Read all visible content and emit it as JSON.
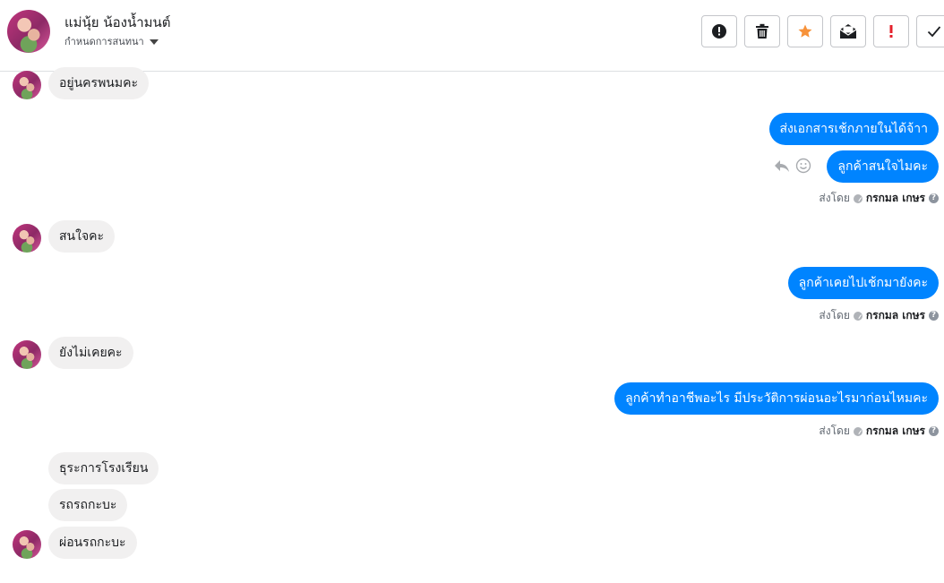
{
  "header": {
    "contact_name": "แม่นุ้ย น้องน้ำมนต์",
    "settings_label": "กำหนดการสนทนา"
  },
  "toolbar": {
    "buttons": [
      "report-spam",
      "delete",
      "star",
      "mark-unread",
      "mark-important",
      "mark-done"
    ]
  },
  "messages": {
    "m1": "อยู่นครพนมคะ",
    "m2": "ส่งเอกสารเช้กภายในได้จ้าา",
    "m3": "ลูกค้าสนใจไมคะ",
    "m4": "สนใจคะ",
    "m5": "ลูกค้าเคยไปเช้กมายังคะ",
    "m6": "ยังไม่เคยคะ",
    "m7": "ลูกค้าทำอาชีพอะไร  มีประวัติการผ่อนอะไรมาก่อนไหมคะ",
    "m8": "ธุระการโรงเรียน",
    "m9": "รถรถกะบะ",
    "m10": "ผ่อนรถกะบะ"
  },
  "sent_by": {
    "prefix": "ส่งโดย",
    "name": "กรกมล เกษร"
  },
  "colors": {
    "outgoing_bubble": "#0084ff",
    "incoming_bubble": "#f1f0f0",
    "star": "#f7923a",
    "important": "#e4202b"
  }
}
